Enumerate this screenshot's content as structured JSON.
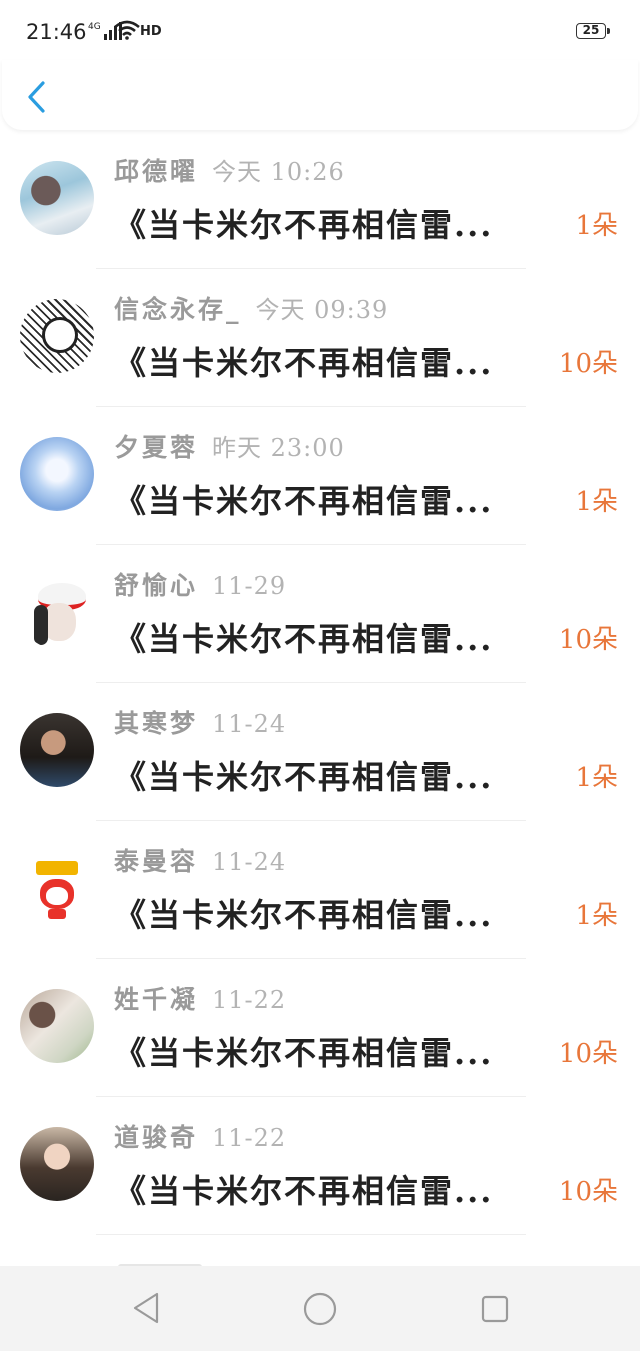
{
  "status_bar": {
    "time": "21:46",
    "network": "4G",
    "hd": "HD",
    "battery": "25"
  },
  "colors": {
    "accent": "#2a9de0",
    "count": "#e8763a"
  },
  "messages": [
    {
      "name": "邱德曜",
      "time": "今天 10:26",
      "title": "《当卡米尔不再相信雷...",
      "count": "1朵",
      "avatar_icon": "girl-long-hair-avatar"
    },
    {
      "name": "信念永存_",
      "time": "今天 09:39",
      "title": "《当卡米尔不再相信雷...",
      "count": "10朵",
      "avatar_icon": "manga-avatar"
    },
    {
      "name": "夕夏蓉",
      "time": "昨天 23:00",
      "title": "《当卡米尔不再相信雷...",
      "count": "1朵",
      "avatar_icon": "anime-girl-avatar"
    },
    {
      "name": "舒愉心",
      "time": "11-29",
      "title": "《当卡米尔不再相信雷...",
      "count": "10朵",
      "avatar_icon": "girl-white-hat-avatar"
    },
    {
      "name": "其寒梦",
      "time": "11-24",
      "title": "《当卡米尔不再相信雷...",
      "count": "1朵",
      "avatar_icon": "girl-portrait-avatar"
    },
    {
      "name": "泰曼容",
      "time": "11-24",
      "title": "《当卡米尔不再相信雷...",
      "count": "1朵",
      "avatar_icon": "cartoon-fox-avatar"
    },
    {
      "name": "姓千凝",
      "time": "11-22",
      "title": "《当卡米尔不再相信雷...",
      "count": "10朵",
      "avatar_icon": "girl-side-face-avatar"
    },
    {
      "name": "道骏奇",
      "time": "11-22",
      "title": "《当卡米尔不再相信雷...",
      "count": "10朵",
      "avatar_icon": "girl-smiling-avatar"
    }
  ]
}
